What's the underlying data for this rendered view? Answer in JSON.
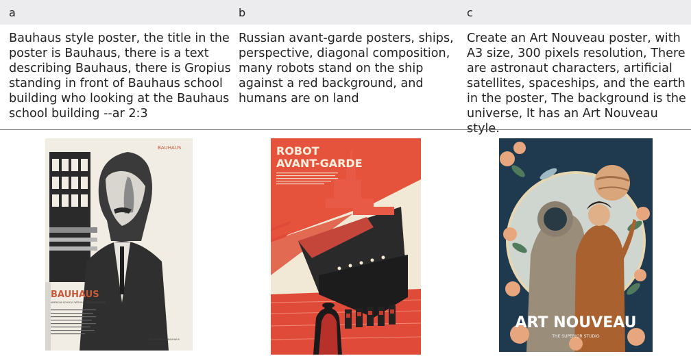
{
  "columns": [
    {
      "header": "a",
      "prompt": "Bauhaus style poster, the title in the poster is Bauhaus, there is a text describing Bauhaus, there is Gropius standing in front of Bauhaus school building who looking at the Bauhaus school building --ar 2:3",
      "poster": {
        "top_label": "BAUHAUS",
        "title": "BAUHAUS",
        "subtitle": "AMERICAN SCHOOLS WITHOUT ENDLESS BORDER",
        "signature": "101 GROPIUS + BAUHAUS"
      }
    },
    {
      "header": "b",
      "prompt": "Russian avant-garde posters, ships, perspective, diagonal composition, many robots stand on the ship against a red background, and humans are on land",
      "poster": {
        "title_line1": "ROBOT",
        "title_line2": "AVANT-GARDE"
      }
    },
    {
      "header": "c",
      "prompt": "Create an Art Nouveau poster, with A3 size, 300 pixels resolution, There are astronaut characters, artificial satellites, spaceships, and the earth in the poster, The background is the universe, It has an Art Nouveau style.",
      "poster": {
        "title": "ART NOUVEAU",
        "subtitle": "THE SUPERIOR STUDIO"
      }
    }
  ]
}
